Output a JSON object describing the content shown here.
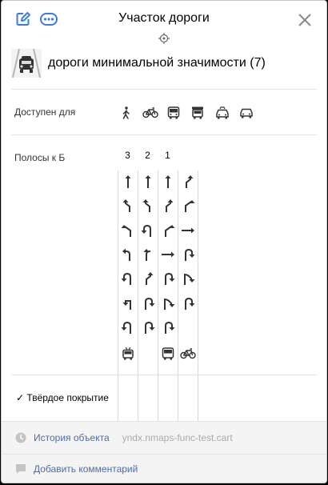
{
  "header": {
    "title": "Участок дороги",
    "edit_icon": "edit-icon",
    "more_icon": "more-icon",
    "close_icon": "close-icon",
    "pin_icon": "crosshair-pin-icon"
  },
  "category": {
    "icon": "road-category-icon",
    "label": "дороги минимальной значимости (7)"
  },
  "access": {
    "label": "Доступен для",
    "vehicles": [
      "pedestrian-icon",
      "bicycle-icon",
      "bus-icon",
      "truck-icon",
      "taxi-icon",
      "car-icon"
    ]
  },
  "lanes": {
    "label": "Полосы к Б",
    "columns": [
      {
        "number": "3",
        "arrows": [
          "straight",
          "straight-left",
          "left",
          "left-straight",
          "uturn-left",
          "left-sharp",
          "uturn-left"
        ],
        "vehicle": "trolleybus-icon"
      },
      {
        "number": "2",
        "arrows": [
          "straight",
          "straight-left",
          "uturn-left",
          "left-up",
          "straight-right",
          "uturn-right",
          "uturn-right"
        ],
        "vehicle": ""
      },
      {
        "number": "1",
        "arrows": [
          "straight",
          "straight-right",
          "right-up",
          "right",
          "uturn-right",
          "right-down",
          "uturn-right"
        ],
        "vehicle": "bus-icon"
      },
      {
        "number": "",
        "arrows": [
          "straight-right",
          "right-up",
          "right",
          "uturn-right",
          "right-down",
          "uturn-right",
          ""
        ],
        "vehicle": "bicycle-icon"
      }
    ]
  },
  "surface": {
    "check": "✓",
    "label": "Твёрдое покрытие"
  },
  "footer": {
    "history_link": "История объекта",
    "history_user": "yndx.nmaps-func-test.cart",
    "comment_link": "Добавить комментарий",
    "history_icon": "clock-icon",
    "comment_icon": "comment-icon"
  }
}
